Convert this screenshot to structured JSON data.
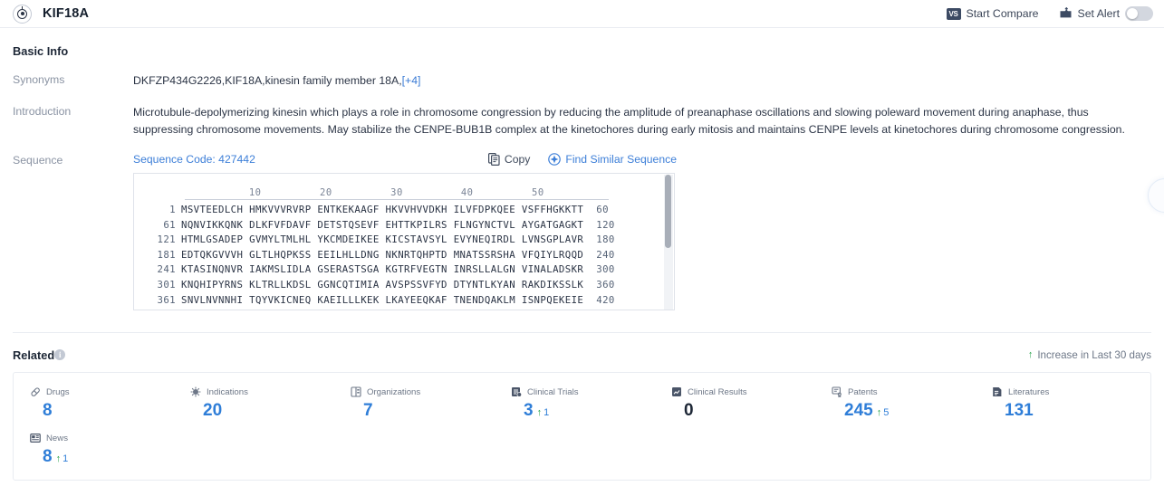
{
  "header": {
    "icon": "target-icon",
    "title": "KIF18A",
    "start_compare_label": "Start Compare",
    "start_compare_badge": "VS",
    "set_alert_label": "Set Alert",
    "alert_toggle_state": "off"
  },
  "basic_info": {
    "title": "Basic Info",
    "synonyms_label": "Synonyms",
    "synonyms_value": "DKFZP434G2226,KIF18A,kinesin family member 18A,",
    "synonyms_more": "[+4]",
    "introduction_label": "Introduction",
    "introduction_value": "Microtubule-depolymerizing kinesin which plays a role in chromosome congression by reducing the amplitude of preanaphase oscillations and slowing poleward movement during anaphase, thus suppressing chromosome movements. May stabilize the CENPE-BUB1B complex at the kinetochores during early mitosis and maintains CENPE levels at kinetochores during chromosome congression.",
    "sequence_label": "Sequence"
  },
  "sequence": {
    "code_label": "Sequence Code: 427442",
    "copy_label": "Copy",
    "find_similar_label": "Find Similar Sequence",
    "ruler_ticks": [
      "10",
      "20",
      "30",
      "40",
      "50"
    ],
    "lines": [
      {
        "start": "1",
        "chunks": "MSVTEEDLCH HMKVVVRVRP ENTKEKAAGF HKVVHVVDKH ILVFDPKQEE VSFFHGKKTT",
        "end": "60"
      },
      {
        "start": "61",
        "chunks": "NQNVIKKQNK DLKFVFDAVF DETSTQSEVF EHTTKPILRS FLNGYNCTVL AYGATGAGKT",
        "end": "120"
      },
      {
        "start": "121",
        "chunks": "HTMLGSADEP GVMYLTMLHL YKCMDEIKEE KICSTAVSYL EVYNEQIRDL LVNSGPLAVR",
        "end": "180"
      },
      {
        "start": "181",
        "chunks": "EDTQKGVVVH GLTLHQPKSS EEILHLLDNG NKNRTQHPTD MNATSSRSHA VFQIYLRQQD",
        "end": "240"
      },
      {
        "start": "241",
        "chunks": "KTASINQNVR IAKMSLIDLA GSERASTSGA KGTRFVEGTN INRSLLALGN VINALADSKR",
        "end": "300"
      },
      {
        "start": "301",
        "chunks": "KNQHIPYRNS KLTRLLKDSL GGNCQTIMIA AVSPSSVFYD DTYNTLKYAN RAKDIKSSLK",
        "end": "360"
      },
      {
        "start": "361",
        "chunks": "SNVLNVNNHI TQYVKICNEQ KAEILLLKEK LKAYEEQKAF TNENDQAKLM ISNPQEKEIE",
        "end": "420"
      }
    ]
  },
  "related": {
    "title": "Related",
    "info_glyph": "i",
    "legend_label": "Increase in Last 30 days",
    "legend_arrow": "↑",
    "cards": [
      {
        "icon": "pill-icon",
        "label": "Drugs",
        "value": "8",
        "delta": "",
        "zero": false
      },
      {
        "icon": "virus-icon",
        "label": "Indications",
        "value": "20",
        "delta": "",
        "zero": false
      },
      {
        "icon": "building-icon",
        "label": "Organizations",
        "value": "7",
        "delta": "",
        "zero": false
      },
      {
        "icon": "clinical-trial-icon",
        "label": "Clinical Trials",
        "value": "3",
        "delta": "1",
        "zero": false
      },
      {
        "icon": "clinical-result-icon",
        "label": "Clinical Results",
        "value": "0",
        "delta": "",
        "zero": true
      },
      {
        "icon": "patent-icon",
        "label": "Patents",
        "value": "245",
        "delta": "5",
        "zero": false
      },
      {
        "icon": "literature-icon",
        "label": "Literatures",
        "value": "131",
        "delta": "",
        "zero": false
      },
      {
        "icon": "news-icon",
        "label": "News",
        "value": "8",
        "delta": "1",
        "zero": false
      }
    ]
  },
  "colors": {
    "accent_blue": "#2f7ed8",
    "link_blue": "#3d7fd8",
    "increase_green": "#24a148",
    "text_dark": "#2b3445",
    "muted": "#8a93a3"
  }
}
